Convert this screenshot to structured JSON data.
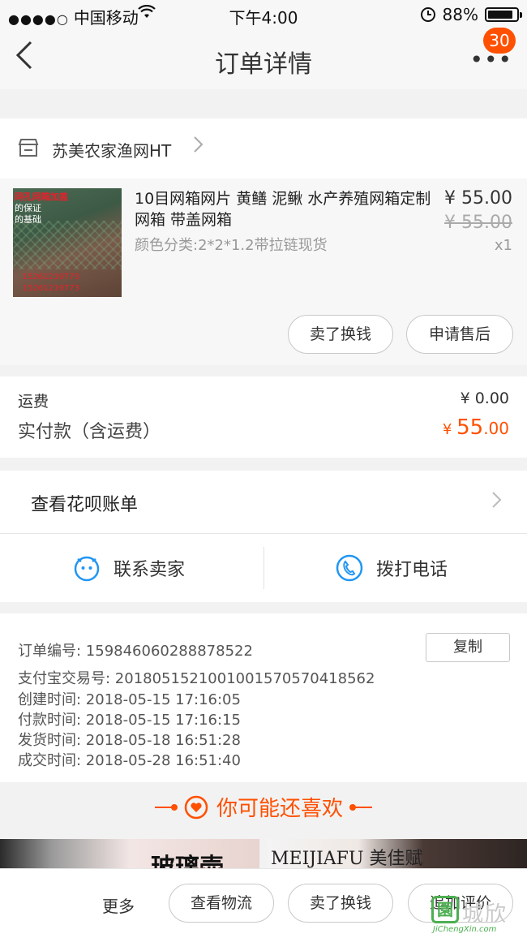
{
  "status_bar": {
    "carrier": "中国移动",
    "time": "下午4:00",
    "battery_percent": "88%",
    "battery_level": 0.88
  },
  "nav": {
    "title": "订单详情",
    "more_label": "•••",
    "badge": "30"
  },
  "shop": {
    "name": "苏美农家渔网HT"
  },
  "item": {
    "thumb_text": [
      "网孔网箱加盖",
      "的保证",
      "的基础",
      "15261219773",
      "15261219773"
    ],
    "name": "10目网箱网片 黄鳝 泥鳅 水产养殖网箱定制网箱 带盖网箱",
    "sku": "颜色分类:2*2*1.2带拉链现货",
    "price": "¥ 55.00",
    "original_price": "¥ 55.00",
    "quantity": "x1",
    "sell_button": "卖了换钱",
    "after_sale_button": "申请售后"
  },
  "fees": {
    "shipping_label": "运费",
    "shipping_value": "¥ 0.00",
    "paid_label": "实付款（含运费）",
    "paid_symbol": "¥ ",
    "paid_int": "55",
    "paid_dec": ".00"
  },
  "huabei": {
    "label": "查看花呗账单"
  },
  "contact": {
    "seller_label": "联系卖家",
    "phone_label": "拨打电话"
  },
  "order_info": {
    "order_no": "订单编号:   159846060288878522",
    "copy_button": "复制",
    "alipay_no": "支付宝交易号:   2018051521001001570570418562",
    "created": "创建时间:   2018-05-15 17:16:05",
    "paid": "付款时间:   2018-05-15 17:16:15",
    "shipped": "发货时间:   2018-05-18 16:51:28",
    "completed": "成交时间:   2018-05-28 16:51:40"
  },
  "recommend": {
    "title": "你可能还喜欢",
    "img1_text": "玻璃壶",
    "img2_text": "MEIJIAFU 美佳赋"
  },
  "bottom_bar": {
    "more": "更多",
    "logistics_button": "查看物流",
    "sell_button": "卖了换钱",
    "review_button": "追加评价"
  },
  "watermark": {
    "logo": "園",
    "cn": "城欣",
    "en": "JiChengXin.com"
  },
  "colors": {
    "accent": "#ff5000",
    "background": "#f2f2f2"
  },
  "icons": [
    "back-icon",
    "more-icon",
    "shop-icon",
    "chevron-right-icon",
    "smile-chat-icon",
    "phone-icon",
    "heart-icon",
    "wifi-icon",
    "alarm-lock-icon",
    "battery-icon"
  ]
}
